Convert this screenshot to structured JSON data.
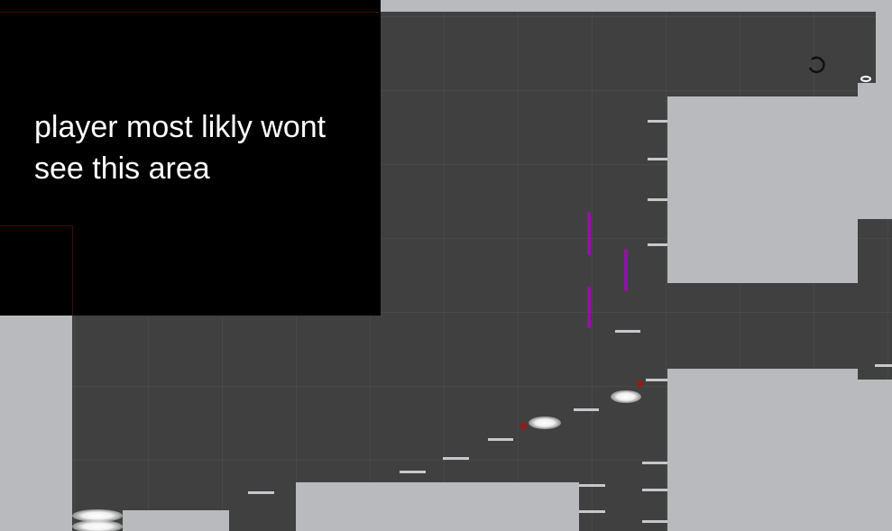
{
  "overlay": {
    "note_text": "player most likly wont see this area",
    "background_color": "#000000"
  },
  "colors": {
    "void": "#404040",
    "solid_block": "#b9babe",
    "ledge": "#c7c8cb",
    "spike": "#8b179b",
    "cloud": "#ffffff",
    "heart": "#8a1f1f"
  },
  "icons": {
    "ring": "circular-arrow-icon",
    "pickup": "ring-pickup-icon"
  }
}
